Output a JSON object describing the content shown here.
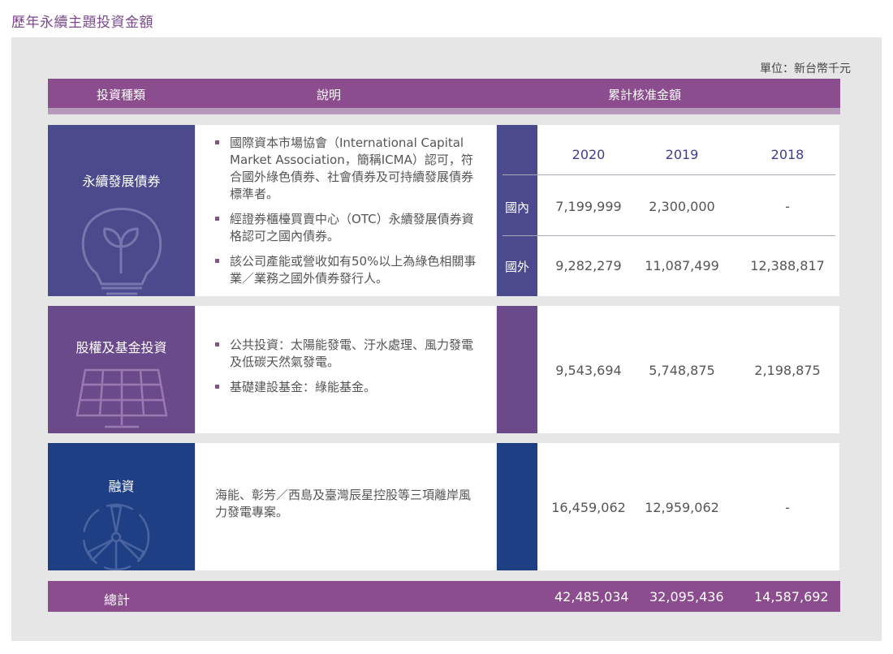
{
  "page_title": "歷年永續主題投資金額",
  "unit": "單位：新台幣千元",
  "header": {
    "type": "投資種類",
    "desc": "說明",
    "amount": "累計核准金額"
  },
  "years": [
    "2020",
    "2019",
    "2018"
  ],
  "rows": [
    {
      "category": "永續發展債券",
      "icon": "lightbulb-plant-icon",
      "bullets": [
        "國際資本市場協會（International Capital Market Association，簡稱ICMA）認可，符合國外綠色債券、社會債券及可持續發展債券標準者。",
        "經證券櫃檯買賣中心（OTC）永續發展債券資格認可之國內債券。",
        "該公司產能或營收如有50%以上為綠色相關事業／業務之國外債券發行人。"
      ],
      "sub": [
        {
          "label": "國內",
          "values": [
            "7,199,999",
            "2,300,000",
            "-"
          ]
        },
        {
          "label": "國外",
          "values": [
            "9,282,279",
            "11,087,499",
            "12,388,817"
          ]
        }
      ]
    },
    {
      "category": "股權及基金投資",
      "icon": "solar-panel-icon",
      "bullets": [
        "公共投資：太陽能發電、汙水處理、風力發電及低碳天然氣發電。",
        "基礎建設基金：綠能基金。"
      ],
      "values": [
        "9,543,694",
        "5,748,875",
        "2,198,875"
      ]
    },
    {
      "category": "融資",
      "icon": "wind-turbine-icon",
      "text": "海能、彰芳／西島及臺灣辰星控股等三項離岸風力發電專案。",
      "values": [
        "16,459,062",
        "12,959,062",
        "-"
      ]
    }
  ],
  "total": {
    "label": "總計",
    "values": [
      "42,485,034",
      "32,095,436",
      "14,587,692"
    ]
  },
  "colors": {
    "purple": "#8b4d8e",
    "indigo": "#4a4a8c",
    "violet": "#6a4a8a",
    "navy": "#1f3f85"
  }
}
